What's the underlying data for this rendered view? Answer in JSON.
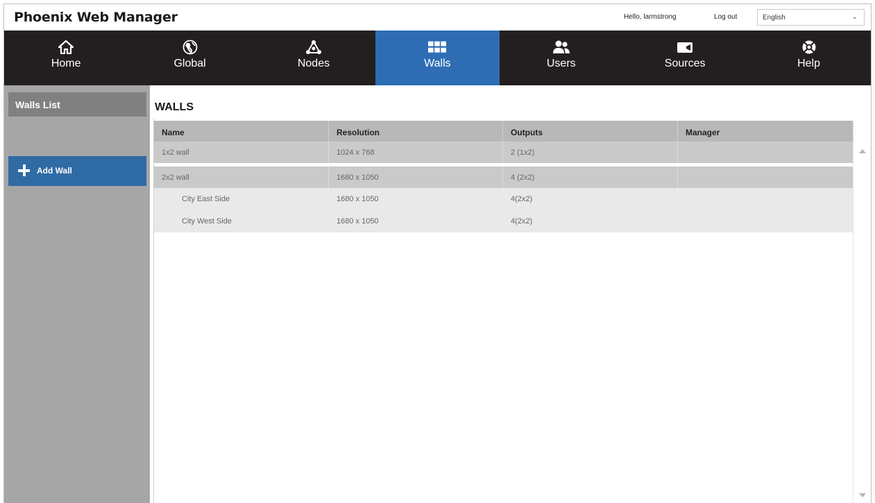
{
  "header": {
    "app_title": "Phoenix Web Manager",
    "greeting": "Hello, larmstrong",
    "logout_label": "Log out",
    "language": "English"
  },
  "nav": {
    "items": [
      {
        "label": "Home",
        "icon": "home-icon"
      },
      {
        "label": "Global",
        "icon": "globe-icon"
      },
      {
        "label": "Nodes",
        "icon": "nodes-icon"
      },
      {
        "label": "Walls",
        "icon": "grid-icon",
        "active": true
      },
      {
        "label": "Users",
        "icon": "users-icon"
      },
      {
        "label": "Sources",
        "icon": "camera-icon"
      },
      {
        "label": "Help",
        "icon": "lifebuoy-icon"
      }
    ],
    "active_color": "#2e6db4",
    "background": "#231f20"
  },
  "sidebar": {
    "title": "Walls List",
    "add_label": "Add Wall",
    "add_color": "#2f6ba4"
  },
  "main": {
    "title": "WALLS",
    "columns": [
      "Name",
      "Resolution",
      "Outputs",
      "Manager"
    ],
    "rows": [
      {
        "name": "1x2 wall",
        "resolution": "1024 x 768",
        "outputs": "2 (1x2)",
        "manager": ""
      },
      {
        "name": "2x2 wall",
        "resolution": "1680 x 1050",
        "outputs": "4 (2x2)",
        "manager": ""
      },
      {
        "name": "City East Side",
        "resolution": "1680 x 1050",
        "outputs": "4(2x2)",
        "manager": ""
      },
      {
        "name": "City West Side",
        "resolution": "1680 x 1050",
        "outputs": "4(2x2)",
        "manager": ""
      }
    ]
  }
}
